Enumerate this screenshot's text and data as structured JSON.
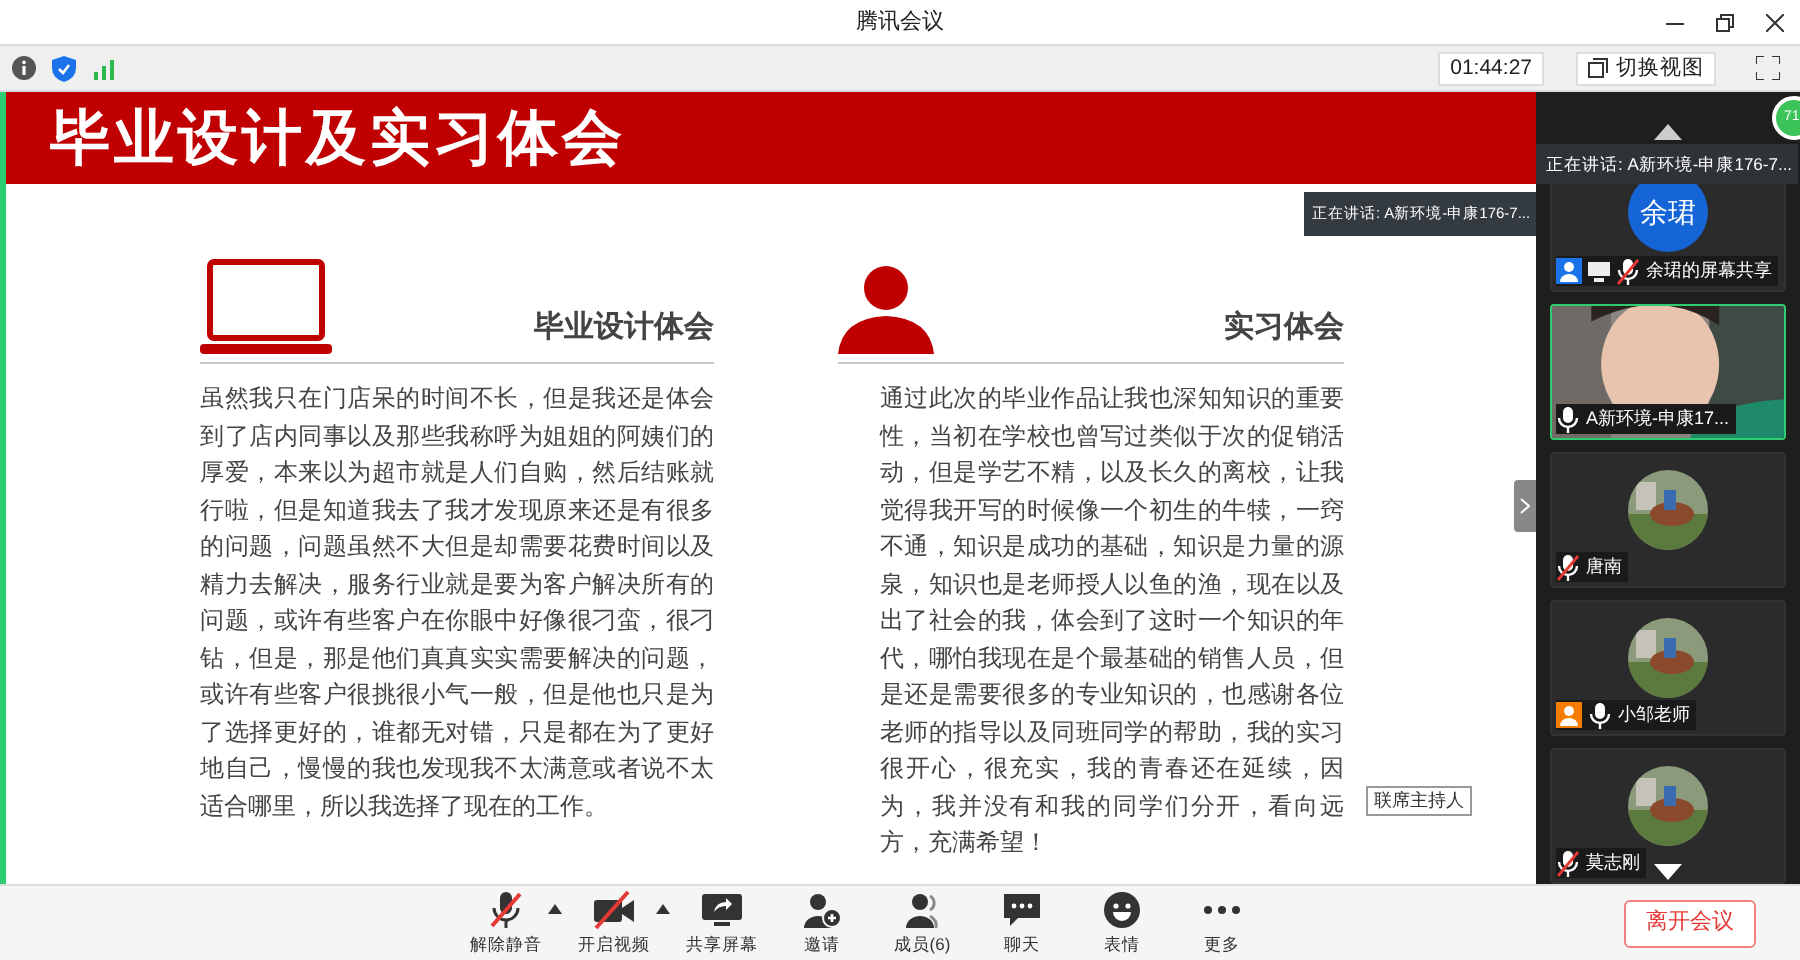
{
  "window": {
    "title": "腾讯会议"
  },
  "toolbar": {
    "time": "01:44:27",
    "view_button": "切换视图"
  },
  "slide": {
    "title": "毕业设计及实习体会",
    "speaking_tooltip": "正在讲话: A新环境-申康176-7...",
    "cohost_label": "联席主持人",
    "sections": [
      {
        "kind": "laptop",
        "heading": "毕业设计体会",
        "body": "虽然我只在门店呆的时间不长，但是我还是体会到了店内同事以及那些我称呼为姐姐的阿姨们的厚爱，本来以为超市就是人们自购，然后结账就行啦，但是知道我去了我才发现原来还是有很多的问题，问题虽然不大但是却需要花费时间以及精力去解决，服务行业就是要为客户解决所有的问题，或许有些客户在你眼中好像很刁蛮，很刁钻，但是，那是他们真真实实需要解决的问题，或许有些客户很挑很小气一般，但是他也只是为了选择更好的，谁都无对错，只是都在为了更好地自己，慢慢的我也发现我不太满意或者说不太适合哪里，所以我选择了现在的工作。"
      },
      {
        "kind": "person",
        "heading": "实习体会",
        "body": "通过此次的毕业作品让我也深知知识的重要性，当初在学校也曾写过类似于次的促销活动，但是学艺不精，以及长久的离校，让我觉得我开写的时候像一个初生的牛犊，一窍不通，知识是成功的基础，知识是力量的源泉，知识也是老师授人以鱼的渔，现在以及出了社会的我，体会到了这时一个知识的年代，哪怕我现在是个最基础的销售人员，但是还是需要很多的专业知识的，也感谢各位老师的指导以及同班同学的帮助，我的实习很开心，很充实，我的青春还在延续，因为，我并没有和我的同学们分开，看向远方，充满希望！"
      }
    ]
  },
  "panel": {
    "speaking_tooltip": "正在讲话: A新环境-申康176-7...",
    "badge": "71",
    "participants": [
      {
        "kind": "initials",
        "initials": "余珺",
        "name": "余珺的屏幕共享",
        "color": "#1a73e8",
        "sharing": true,
        "muted": true,
        "selected": false
      },
      {
        "kind": "video",
        "name": "A新环境-申康17...",
        "sharing": false,
        "muted": false,
        "selected": true
      },
      {
        "name": "唐南",
        "sharing": false,
        "muted": true,
        "selected": false
      },
      {
        "name": "小邹老师",
        "color": "#f57c00",
        "sharing": false,
        "muted": false,
        "selected": false
      },
      {
        "name": "莫志刚",
        "sharing": false,
        "muted": true,
        "selected": false
      }
    ]
  },
  "controls": [
    {
      "kind": "mic",
      "label": "解除静音",
      "muted": true,
      "menu": true
    },
    {
      "kind": "video",
      "label": "开启视频",
      "muted": true,
      "menu": true
    },
    {
      "kind": "share",
      "label": "共享屏幕"
    },
    {
      "kind": "invite",
      "label": "邀请"
    },
    {
      "kind": "members",
      "label": "成员(6)"
    },
    {
      "kind": "chat",
      "label": "聊天"
    },
    {
      "kind": "emoji",
      "label": "表情"
    },
    {
      "kind": "more",
      "label": "更多"
    }
  ],
  "leave_button": "离开会议"
}
